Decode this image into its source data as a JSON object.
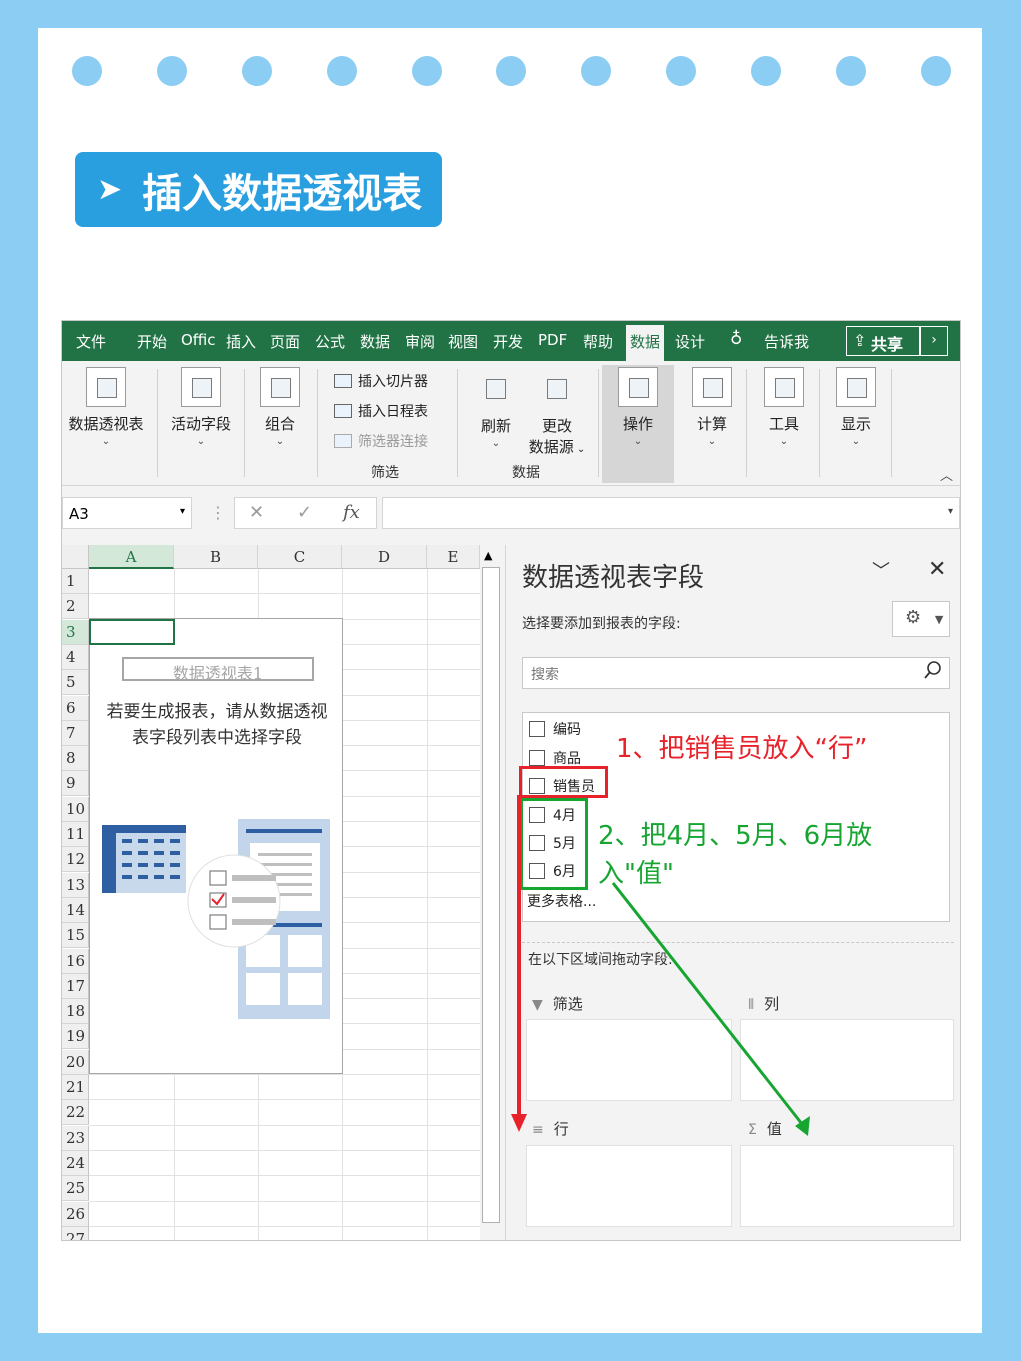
{
  "header": {
    "title": "插入数据透视表",
    "arrow_glyph": "➤"
  },
  "tabs": [
    "文件",
    "开始",
    "Offic",
    "插入",
    "页面",
    "公式",
    "数据",
    "审阅",
    "视图",
    "开发",
    "PDF",
    "帮助",
    "数据",
    "设计",
    "告诉我"
  ],
  "share_label": "共享",
  "more_label": "›",
  "ribbon": {
    "pivot_table": "数据透视表",
    "active_field": "活动字段",
    "group": "组合",
    "insert_slicer": "插入切片器",
    "insert_timeline": "插入日程表",
    "filter_connections": "筛选器连接",
    "filter_group": "筛选",
    "refresh": "刷新",
    "change_source_1": "更改",
    "change_source_2": "数据源",
    "data_group": "数据",
    "actions": "操作",
    "calculations": "计算",
    "tools": "工具",
    "show": "显示"
  },
  "formula_bar": {
    "name_box": "A3",
    "cancel": "✕",
    "enter": "✓",
    "fx": "fx"
  },
  "grid": {
    "columns": [
      "A",
      "B",
      "C",
      "D",
      "E"
    ],
    "rows": [
      "1",
      "2",
      "3",
      "4",
      "5",
      "6",
      "7",
      "8",
      "9",
      "10",
      "11",
      "12",
      "13",
      "14",
      "15",
      "16",
      "17",
      "18",
      "19",
      "20",
      "21",
      "22",
      "23",
      "24",
      "25",
      "26",
      "27"
    ],
    "pivot_name": "数据透视表1",
    "pivot_msg": "若要生成报表，请从数据透视表字段列表中选择字段"
  },
  "pane": {
    "title": "数据透视表字段",
    "subtitle": "选择要添加到报表的字段:",
    "search_placeholder": "搜索",
    "fields": [
      "编码",
      "商品",
      "销售员",
      "4月",
      "5月",
      "6月"
    ],
    "more_tables": "更多表格...",
    "drag_label": "在以下区域间拖动字段:",
    "areas": {
      "filter": "筛选",
      "columns": "列",
      "rows": "行",
      "values": "值"
    }
  },
  "annotations": {
    "step1": "1、把销售员放入“行”",
    "step2_line1": "2、把4月、5月、6月放",
    "step2_line2": "入\"值\""
  },
  "colors": {
    "excel_green": "#217346",
    "badge_blue": "#2a9fe0",
    "frame_blue": "#8ccdf3",
    "annotation_red": "#e8222a",
    "annotation_green": "#17a532"
  }
}
